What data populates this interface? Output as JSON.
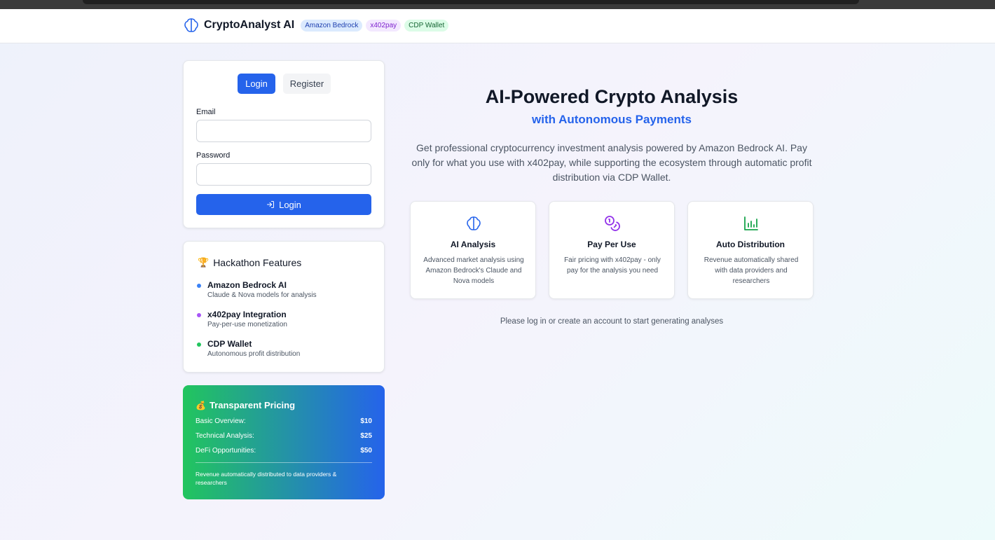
{
  "header": {
    "brand": "CryptoAnalyst AI",
    "badges": [
      "Amazon Bedrock",
      "x402pay",
      "CDP Wallet"
    ]
  },
  "auth": {
    "tabs": [
      "Login",
      "Register"
    ],
    "active_tab": "Login",
    "email_label": "Email",
    "email_value": "",
    "password_label": "Password",
    "password_value": "",
    "submit_label": "Login"
  },
  "features_panel": {
    "icon": "🏆",
    "title": "Hackathon Features",
    "items": [
      {
        "title": "Amazon Bedrock AI",
        "desc": "Claude & Nova models for analysis",
        "color": "#3b82f6"
      },
      {
        "title": "x402pay Integration",
        "desc": "Pay-per-use monetization",
        "color": "#a855f7"
      },
      {
        "title": "CDP Wallet",
        "desc": "Autonomous profit distribution",
        "color": "#22c55e"
      }
    ]
  },
  "pricing": {
    "icon": "💰",
    "title": "Transparent Pricing",
    "rows": [
      {
        "label": "Basic Overview:",
        "price": "$10"
      },
      {
        "label": "Technical Analysis:",
        "price": "$25"
      },
      {
        "label": "DeFi Opportunities:",
        "price": "$50"
      }
    ],
    "note": "Revenue automatically distributed to data providers & researchers"
  },
  "hero": {
    "title": "AI-Powered Crypto Analysis",
    "subtitle": "with Autonomous Payments",
    "description": "Get professional cryptocurrency investment analysis powered by Amazon Bedrock AI. Pay only for what you use with x402pay, while supporting the ecosystem through automatic profit distribution via CDP Wallet."
  },
  "feature_cards": [
    {
      "icon": "brain-icon",
      "title": "AI Analysis",
      "desc": "Advanced market analysis using Amazon Bedrock's Claude and Nova models",
      "color": "#2563eb"
    },
    {
      "icon": "coins-icon",
      "title": "Pay Per Use",
      "desc": "Fair pricing with x402pay - only pay for the analysis you need",
      "color": "#9333ea"
    },
    {
      "icon": "bar-chart-icon",
      "title": "Auto Distribution",
      "desc": "Revenue automatically shared with data providers and researchers",
      "color": "#16a34a"
    }
  ],
  "prompt": "Please log in or create an account to start generating analyses"
}
